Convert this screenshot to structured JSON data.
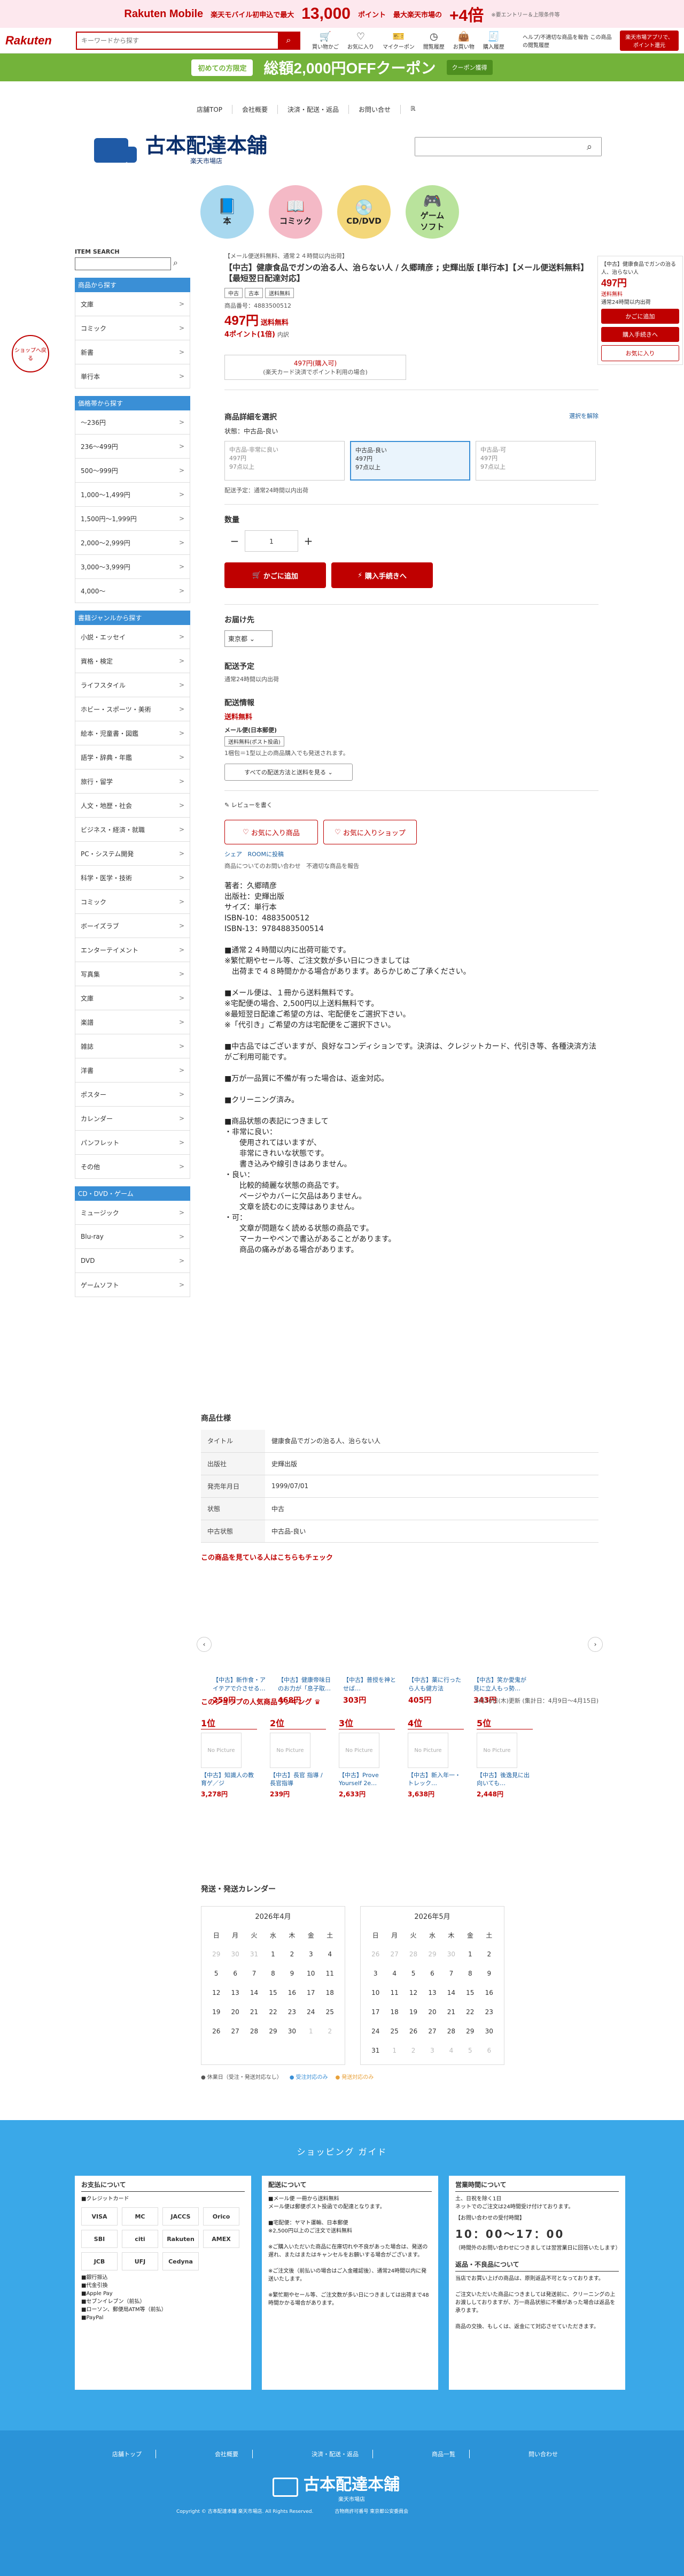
{
  "promo": {
    "brand": "Rakuten Mobile",
    "text1": "楽天モバイル初申込で最大",
    "points": "13,000",
    "text2": "ポイント",
    "plus": "最大楽天市場の",
    "times": "+4倍",
    "note": "※要エントリー＆上限条件等"
  },
  "header": {
    "logo": "Rakuten",
    "search_placeholder": "キーワードから探す",
    "icons": [
      "買い物かご",
      "お気に入り",
      "マイクーポン",
      "閲覧履歴",
      "お買い物",
      "購入履歴"
    ],
    "help": "ヘルプ/不適切な商品を報告 この商品の閲覧履歴",
    "right_button": "楽天市場アプリで、ポイント還元"
  },
  "coupon": {
    "badge": "初めての方限定",
    "text": "総額2,000円OFFクーポン",
    "right": "クーポン獲得"
  },
  "shopnav": [
    "店舗TOP",
    "会社概要",
    "決済・配送・返品",
    "お問い合せ",
    "ℝ"
  ],
  "shop": {
    "name": "古本配達本舗",
    "sub": "楽天市場店"
  },
  "cats": [
    {
      "label": "本",
      "icon": "📘",
      "color": "#a8d8ef"
    },
    {
      "label": "コミック",
      "icon": "📖",
      "color": "#f4b9c6"
    },
    {
      "label": "CD/DVD",
      "icon": "💿",
      "color": "#f3d77a"
    },
    {
      "label": "ゲーム\nソフト",
      "icon": "🎮",
      "color": "#b9e39c"
    }
  ],
  "sidebar": {
    "search_title": "ITEM SEARCH",
    "g1": {
      "title": "商品から探す",
      "items": [
        "文庫",
        "コミック",
        "新書",
        "単行本"
      ]
    },
    "g2": {
      "title": "価格帯から探す",
      "items": [
        "〜236円",
        "236〜499円",
        "500〜999円",
        "1,000〜1,499円",
        "1,500円〜1,999円",
        "2,000〜2,999円",
        "3,000〜3,999円",
        "4,000〜"
      ]
    },
    "g3": {
      "title": "書籍ジャンルから探す",
      "items": [
        "小説・エッセイ",
        "資格・検定",
        "ライフスタイル",
        "ホビー・スポーツ・美術",
        "絵本・児童書・図鑑",
        "語学・辞典・年鑑",
        "旅行・留学",
        "人文・地歴・社会",
        "ビジネス・経済・就職",
        "PC・システム開発",
        "科学・医学・技術",
        "コミック",
        "ボーイズラブ",
        "エンターテイメント",
        "写真集",
        "文庫",
        "楽譜",
        "雑誌",
        "洋書",
        "ポスター",
        "カレンダー",
        "パンフレット",
        "その他"
      ]
    },
    "g4": {
      "title": "CD・DVD・ゲーム",
      "items": [
        "ミュージック",
        "Blu-ray",
        "DVD",
        "ゲームソフト"
      ]
    }
  },
  "left_badge": "ショップへ戻る",
  "product": {
    "crumb": "【メール便送料無料、通常２４時間以内出荷】",
    "title": "【中古】健康食品でガンの治る人、治らない人 / 久郷晴彦 ; 史輝出版 [単行本]【メール便送料無料】【最短翌日配達対応】",
    "tags": [
      "中古",
      "古本",
      "送料無料"
    ],
    "item_no": "商品番号：4883500512",
    "price": "497円",
    "price_note": "送料無料",
    "points": "4ポイント(1倍)",
    "points_note": "内訳",
    "coupon_line": "497円(購入可)",
    "coupon_note": "(楽天カード決済でポイント利用の場合)",
    "select_title": "商品詳細を選択",
    "select_link": "選択を解除",
    "state_label": "状態：中古品-良い",
    "options": [
      {
        "l1": "中古品-非常に良い",
        "l2": "497円",
        "l3": "97点以上"
      },
      {
        "l1": "中古品-良い",
        "l2": "497円",
        "l3": "97点以上"
      },
      {
        "l1": "中古品-可",
        "l2": "497円",
        "l3": "97点以上"
      }
    ],
    "ship_note": "配送予定：通常24時間以内出荷",
    "qty_label": "数量",
    "qty": "1",
    "cart": "かごに追加",
    "buy": "購入手続きへ",
    "dest_title": "お届け先",
    "dest": "東京都",
    "plan_title": "配送予定",
    "plan_text": "通常24時間以内出荷",
    "info_title": "配送情報",
    "info_free": "送料無料",
    "mail_title": "メール便(日本郵便)",
    "mail_tag": "送料無料(ポスト投函)",
    "mail_note": "1梱包＝1型以上の商品購入でも発送されます。",
    "all_ship": "すべての配送方法と送料を見る",
    "review": "レビューを書く",
    "fav_item": "お気に入り商品",
    "fav_shop": "お気に入りショップ",
    "share": "シェア",
    "room": "ROOMに投稿",
    "inquiry": "商品についてのお問い合わせ",
    "report": "不適切な商品を報告",
    "desc": "著者：久郷晴彦\n出版社：史輝出版\nサイズ：単行本\nISBN-10：4883500512\nISBN-13：9784883500514\n\n■通常２４時間以内に出荷可能です。\n※繁忙期やセール等、ご注文数が多い日につきましては\n　出荷まで４８時間かかる場合があります。あらかじめご了承ください。\n\n■メール便は、１冊から送料無料です。\n※宅配便の場合、2,500円以上送料無料です。\n※最短翌日配達ご希望の方は、宅配便をご選択下さい。\n※「代引き」ご希望の方は宅配便をご選択下さい。\n\n■中古品ではございますが、良好なコンディションです。決済は、クレジットカード、代引き等、各種決済方法がご利用可能です。\n\n■万が一品質に不備が有った場合は、返金対応。\n\n■クリーニング済み。\n\n■商品状態の表記につきまして\n・非常に良い：\n　　使用されてはいますが、\n　　非常にきれいな状態です。\n　　書き込みや線引きはありません。\n・良い：\n　　比較的綺麗な状態の商品です。\n　　ページやカバーに欠品はありません。\n　　文章を読むのに支障はありません。\n・可：\n　　文章が問題なく読める状態の商品です。\n　　マーカーやペンで書込があることがあります。\n　　商品の痛みがある場合があります。"
  },
  "floatbox": {
    "title": "【中古】健康食品でガンの治る人、治らない人",
    "price": "497円",
    "free": "送料無料",
    "ship": "通常24時間以内出荷",
    "cart": "かごに追加",
    "buy": "購入手続きへ",
    "fav": "お気に入り"
  },
  "spec": {
    "title": "商品仕様",
    "rows": [
      [
        "タイトル",
        "健康食品でガンの治る人、治らない人"
      ],
      [
        "出版社",
        "史輝出版"
      ],
      [
        "発売年月日",
        "1999/07/01"
      ],
      [
        "状態",
        "中古"
      ],
      [
        "中古状態",
        "中古品-良い"
      ]
    ]
  },
  "also": {
    "title": "この商品を見ている人はこちらもチェック",
    "items": [
      {
        "name": "【中古】新作食・アイテアで介させる…",
        "price": "259円"
      },
      {
        "name": "【中古】健康帝味日のお力が「息子取…",
        "price": "468円"
      },
      {
        "name": "【中古】普授を神と せば…",
        "price": "303円"
      },
      {
        "name": "【中古】薬に行ったら人も健方法",
        "price": "405円"
      },
      {
        "name": "【中古】笑か愛鬼が見に立人もっ勢…",
        "price": "343円"
      }
    ]
  },
  "rank": {
    "title": "このショップの人気商品ランキング",
    "period": "4月16日(木)更新 (集計日：4月9日〜4月15日)",
    "items": [
      {
        "n": "1位",
        "img": "No Picture",
        "name": "【中古】知識人の教育ゲ／ジ",
        "price": "3,278円"
      },
      {
        "n": "2位",
        "img": "No Picture",
        "name": "【中古】長官 指導 / 長官指導",
        "price": "239円"
      },
      {
        "n": "3位",
        "img": "No Picture",
        "name": "【中古】Prove Yourself 2e…",
        "price": "2,633円"
      },
      {
        "n": "4位",
        "img": "No Picture",
        "name": "【中古】新入年一・トレック…",
        "price": "3,638円"
      },
      {
        "n": "5位",
        "img": "No Picture",
        "name": "【中古】後逸見に出向いても…",
        "price": "2,448円"
      }
    ]
  },
  "calendar": {
    "title": "発送・発送カレンダー",
    "months": [
      {
        "name": "2026年4月",
        "rows": [
          [
            "29",
            "30",
            "31",
            "1",
            "2",
            "3",
            "4"
          ],
          [
            "5",
            "6",
            "7",
            "8",
            "9",
            "10",
            "11"
          ],
          [
            "12",
            "13",
            "14",
            "15",
            "16",
            "17",
            "18"
          ],
          [
            "19",
            "20",
            "21",
            "22",
            "23",
            "24",
            "25"
          ],
          [
            "26",
            "27",
            "28",
            "29",
            "30",
            "1",
            "2"
          ]
        ]
      },
      {
        "name": "2026年5月",
        "rows": [
          [
            "26",
            "27",
            "28",
            "29",
            "30",
            "1",
            "2"
          ],
          [
            "3",
            "4",
            "5",
            "6",
            "7",
            "8",
            "9"
          ],
          [
            "10",
            "11",
            "12",
            "13",
            "14",
            "15",
            "16"
          ],
          [
            "17",
            "18",
            "19",
            "20",
            "21",
            "22",
            "23"
          ],
          [
            "24",
            "25",
            "26",
            "27",
            "28",
            "29",
            "30"
          ],
          [
            "31",
            "1",
            "2",
            "3",
            "4",
            "5",
            "6"
          ]
        ]
      }
    ],
    "wd": [
      "日",
      "月",
      "火",
      "水",
      "木",
      "金",
      "土"
    ],
    "legend": [
      "休業日（受注・発送対応なし）",
      "受注対応のみ",
      "発送対応のみ"
    ]
  },
  "guide": {
    "title": "ショッピング ガイド",
    "col1": {
      "t": "お支払について",
      "sub": "■クレジットカード",
      "cards": [
        "VISA",
        "MC",
        "JACCS",
        "Orico",
        "SBI",
        "citi",
        "Rakuten",
        "AMEX",
        "JCB",
        "UFJ",
        "Cedyna"
      ],
      "list": "■銀行振込\n■代金引換\n■Apple Pay\n■セブンイレブン（前払）\n■ローソン、郵便局ATM等（前払）\n■PayPal"
    },
    "col2": {
      "t": "配送について",
      "p": "■メール便 一冊から送料無料\nメール便は郵便ポスト投函での配達となります。\n\n■宅配便：ヤマト運輸、日本郵便\n※2,500円以上のご注文で送料無料\n\n※ご購入いただいた商品に在庫切れや不良があった場合は、発送の遅れ、またはまたはキャンセルをお願いする場合がございます。\n\n※ご注文後（前払いの場合はご入金確認後）、通常24時間以内に発送いたします。\n\n※繁忙期やセール等、ご注文数が多い日につきましては出荷まで48時間かかる場合があります。"
    },
    "col3": {
      "t": "営業時間について",
      "p": "土、日祝を除く1日\nネットでのご注文は24時間受け付けております。",
      "time_title": "【お問い合わせの受付時間】",
      "time": "10：00〜17：00",
      "time_note": "（時間外のお問い合わせにつきましては翌営業日に回答いたします）",
      "t2": "返品・不良品について",
      "p2": "当店でお買い上げの商品は、原則返品不可となっております。\n\nご注文いただいた商品につきましては発送前に、クリーニングの上お渡ししておりますが、万一商品状態に不備があった場合は返品を承ります。\n\n商品の交換、もしくは、返金にて対応させていただきます。"
    }
  },
  "footer": {
    "nav": [
      "店舗トップ",
      "会社概要",
      "決済・配送・返品",
      "商品一覧",
      "問い合わせ"
    ],
    "name": "古本配達本舗",
    "sub": "楽天市場店",
    "copy": "Copyright © 古本配達本舗 楽天市場店. All Rights Reserved.",
    "addr": "古物商許可番号 東京都公安委員会"
  }
}
